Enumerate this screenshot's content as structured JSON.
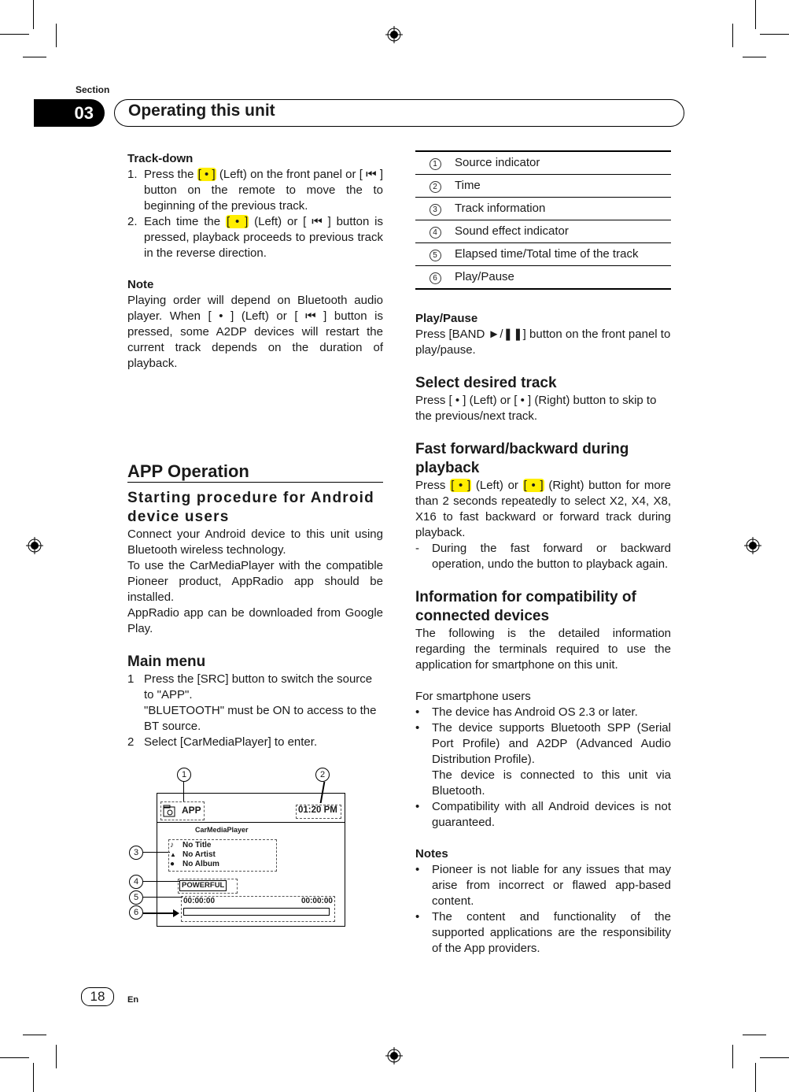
{
  "header": {
    "section_label": "Section",
    "section_number": "03",
    "section_title": "Operating this unit"
  },
  "left": {
    "track_down": {
      "title": "Track-down",
      "steps": [
        {
          "num": "1.",
          "pre": "Press the ",
          "key": "[ • ]",
          "post": " (Left) on the front panel or [ ⏮ ] button on the remote to move the to beginning of the previous track."
        },
        {
          "num": "2.",
          "pre": "Each time the ",
          "key": "[ • ]",
          "post": " (Left) or [ ⏮ ] button is pressed, playback proceeds to previous track in the reverse direction."
        }
      ]
    },
    "note": {
      "title": "Note",
      "text": "Playing order will depend on Bluetooth audio player. When [ • ] (Left) or [ ⏮ ] button is pressed, some A2DP devices will restart the current track depends on the duration of playback."
    },
    "app_operation": {
      "title": "APP Operation",
      "subtitle": "Starting procedure for Android device users",
      "paragraphs": [
        "Connect your Android device to this unit using Bluetooth wireless technology.",
        "To use the CarMediaPlayer with the compatible Pioneer product, AppRadio app should be installed.",
        "AppRadio app can be downloaded from Google Play."
      ]
    },
    "main_menu": {
      "title": "Main menu",
      "steps": [
        {
          "num": "1",
          "text": "Press the [SRC] button to switch the source to \"APP\".",
          "extra": "\"BLUETOOTH\" must be ON to access to the BT source."
        },
        {
          "num": "2",
          "text": "Select [CarMediaPlayer] to enter."
        }
      ]
    },
    "diagram": {
      "source": "APP",
      "time": "01:20 PM",
      "app_name": "CarMediaPlayer",
      "title": "No Title",
      "artist": "No Artist",
      "album": "No Album",
      "sound_effect": "POWERFUL",
      "elapsed": "00:00:00",
      "total": "00:00:00",
      "progress_percent": 0,
      "callouts": [
        "1",
        "2",
        "3",
        "4",
        "5",
        "6"
      ]
    }
  },
  "right": {
    "legend": [
      {
        "num": "1",
        "label": "Source indicator"
      },
      {
        "num": "2",
        "label": "Time"
      },
      {
        "num": "3",
        "label": "Track information"
      },
      {
        "num": "4",
        "label": "Sound effect indicator"
      },
      {
        "num": "5",
        "label": "Elapsed time/Total time of the track"
      },
      {
        "num": "6",
        "label": "Play/Pause"
      }
    ],
    "play_pause": {
      "title": "Play/Pause",
      "text": "Press [BAND ►/❚❚] button on the front panel to play/pause."
    },
    "select_track": {
      "title": "Select desired track",
      "text": "Press [ • ] (Left) or [ • ] (Right) button to skip to the previous/next track."
    },
    "fast_forward": {
      "title": "Fast forward/backward during playback",
      "pre": "Press ",
      "key1": "[ • ]",
      "mid": " (Left) or ",
      "key2": "[ • ]",
      "post": " (Right) button for more than 2 seconds repeatedly to select X2, X4, X8, X16 to fast backward or forward track during playback.",
      "dash_item": "During the fast forward or backward operation, undo the button to playback again."
    },
    "compat": {
      "title": "Information for compatibility of connected devices",
      "intro": "The following is the detailed information regarding the terminals required to use the application for smartphone on this unit.",
      "for_users": "For smartphone users",
      "bullets": [
        "The device has Android OS 2.3 or later.",
        "The device supports Bluetooth SPP (Serial Port Profile) and A2DP (Advanced Audio Distribution Profile).",
        "Compatibility with all Android devices is not guaranteed."
      ],
      "bullet2_extra": "The device is connected to this unit via Bluetooth."
    },
    "notes": {
      "title": "Notes",
      "bullets": [
        "Pioneer is not liable for any issues that may arise from incorrect or flawed app-based content.",
        "The content and functionality of the supported applications are the responsibility of the App providers."
      ]
    }
  },
  "footer": {
    "page_number": "18",
    "language": "En"
  }
}
